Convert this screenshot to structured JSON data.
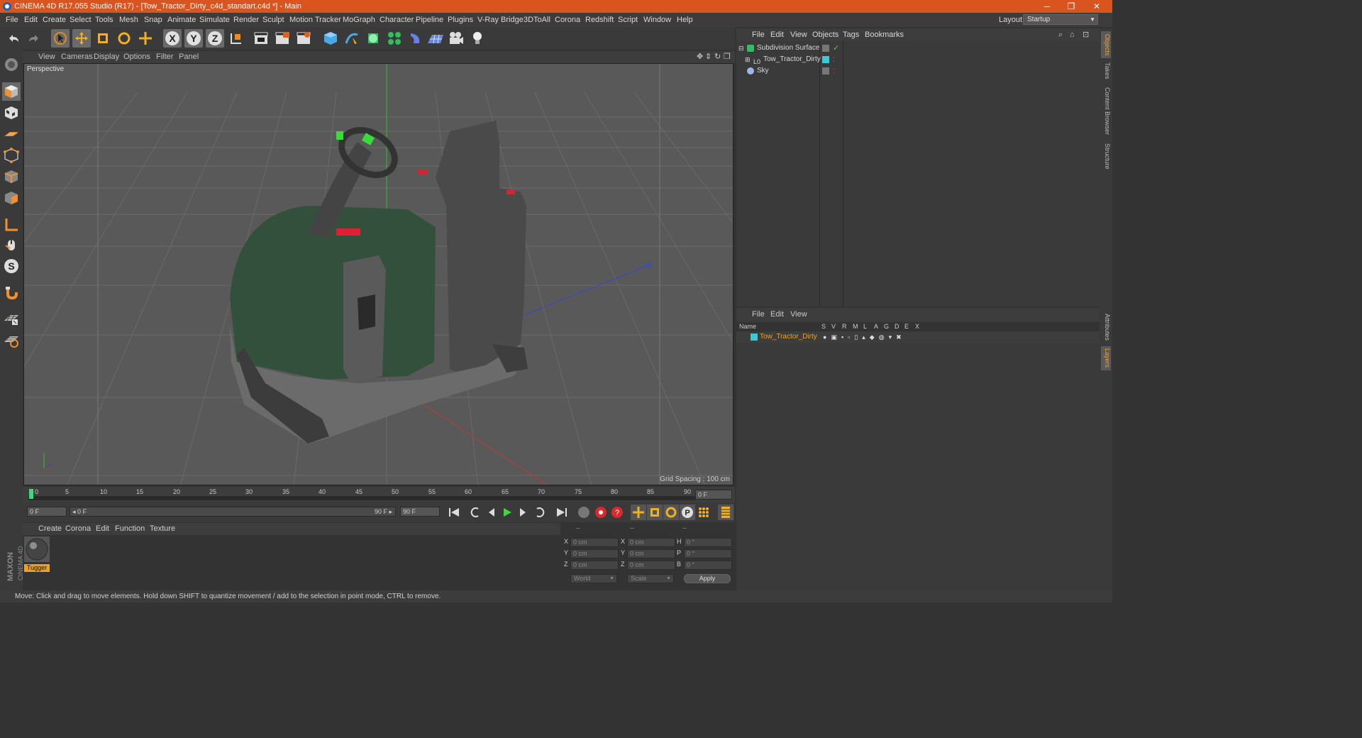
{
  "window": {
    "title": "CINEMA 4D R17.055 Studio (R17) - [Tow_Tractor_Dirty_c4d_standart.c4d *] - Main",
    "controls": {
      "minimize": "─",
      "restore": "❐",
      "close": "✕"
    }
  },
  "menubar": {
    "items": [
      "File",
      "Edit",
      "Create",
      "Select",
      "Tools",
      "Mesh",
      "Snap",
      "Animate",
      "Simulate",
      "Render",
      "Sculpt",
      "Motion Tracker",
      "MoGraph",
      "Character",
      "Pipeline",
      "Plugins",
      "V-Ray Bridge",
      "3DToAll",
      "Corona",
      "Redshift",
      "Script",
      "Window",
      "Help"
    ],
    "layout_label": "Layout:",
    "layout_value": "Startup"
  },
  "toolbar": {
    "icons": [
      "undo-icon",
      "redo-icon",
      "select-arrow-icon",
      "move-icon",
      "scale-icon",
      "rotate-icon",
      "move-multi-icon",
      "x-axis-icon",
      "y-axis-icon",
      "z-axis-icon",
      "world-coords-icon",
      "render-view-icon",
      "render-picture-viewer-icon",
      "edit-render-settings-icon",
      "cube-primitive-icon",
      "pen-spline-icon",
      "subdivision-generator-icon",
      "cloner-icon",
      "deformer-icon",
      "floor-icon",
      "camera-icon",
      "light-icon"
    ],
    "axis_labels": [
      "X",
      "Y",
      "Z"
    ]
  },
  "left_tools": {
    "icons": [
      "make-editable-icon",
      "model-mode-icon",
      "texture-mode-icon",
      "workplane-icon",
      "points-mode-icon",
      "edges-mode-icon",
      "polygons-mode-icon",
      "axis-mode-icon",
      "tweak-mode-icon",
      "solo-s-icon",
      "magnet-icon",
      "snap-grid-icon",
      "snap-settings-icon"
    ],
    "solo_label": "S"
  },
  "viewport": {
    "menu": [
      "View",
      "Cameras",
      "Display",
      "Options",
      "Filter",
      "Panel"
    ],
    "label": "Perspective",
    "grid_spacing": "Grid Spacing : 100 cm",
    "colors": {
      "bg": "#595959",
      "grid": "#666666",
      "green_axis": "#2ec02e",
      "red_axis": "#c23a2a",
      "blue_axis": "#3848d0",
      "body_green": "#33503d"
    }
  },
  "timeline": {
    "ticks": [
      "0",
      "5",
      "10",
      "15",
      "20",
      "25",
      "30",
      "35",
      "40",
      "45",
      "50",
      "55",
      "60",
      "65",
      "70",
      "75",
      "80",
      "85",
      "90"
    ],
    "current_frame": "0 F"
  },
  "playbar": {
    "start_field": "0 F",
    "range_start": "◂ 0 F",
    "range_end": "90 F ▸",
    "end_field": "90 F"
  },
  "materials": {
    "menu": [
      "Create",
      "Corona",
      "Edit",
      "Function",
      "Texture"
    ],
    "items": [
      {
        "name": "Tugger"
      }
    ]
  },
  "coordinates": {
    "headers": [
      "--",
      "--",
      "--"
    ],
    "rows": [
      {
        "a": "X",
        "av": "0 cm",
        "b": "X",
        "bv": "0 cm",
        "c": "H",
        "cv": "0 °"
      },
      {
        "a": "Y",
        "av": "0 cm",
        "b": "Y",
        "bv": "0 cm",
        "c": "P",
        "cv": "0 °"
      },
      {
        "a": "Z",
        "av": "0 cm",
        "b": "Z",
        "bv": "0 cm",
        "c": "B",
        "cv": "0 °"
      }
    ],
    "mode_select": "World",
    "scale_select": "Scale",
    "apply_label": "Apply"
  },
  "object_manager": {
    "menu": [
      "File",
      "Edit",
      "View",
      "Objects",
      "Tags",
      "Bookmarks"
    ],
    "objects": [
      {
        "name": "Subdivision Surface",
        "icon": "subdivision-icon"
      },
      {
        "name": "Tow_Tractor_Dirty",
        "icon": "null-object-icon"
      },
      {
        "name": "Sky",
        "icon": "sky-icon"
      }
    ]
  },
  "layer_manager": {
    "menu": [
      "File",
      "Edit",
      "View"
    ],
    "columns": [
      "Name",
      "S",
      "V",
      "R",
      "M",
      "L",
      "A",
      "G",
      "D",
      "E",
      "X"
    ],
    "layers": [
      {
        "name": "Tow_Tractor_Dirty",
        "color": "#3ec8d8"
      }
    ]
  },
  "right_tabs": [
    "Objects",
    "Takes",
    "Content Browser",
    "Structure",
    "Attributes",
    "Layers"
  ],
  "status": "Move: Click and drag to move elements. Hold down SHIFT to quantize movement / add to the selection in point mode, CTRL to remove.",
  "brand": {
    "line1": "MAXON",
    "line2": "CINEMA 4D"
  }
}
